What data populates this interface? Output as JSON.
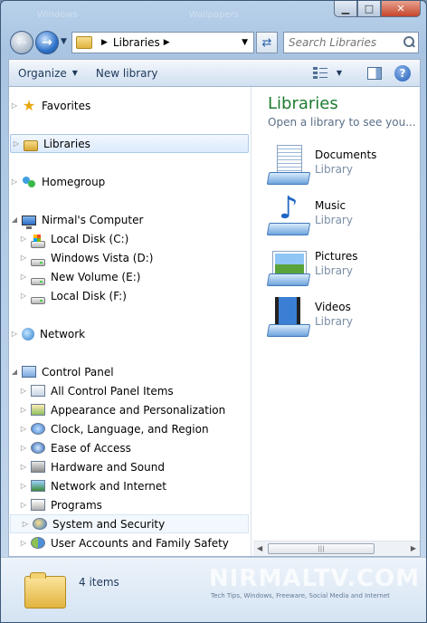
{
  "window": {
    "title_ghost": [
      "Windows",
      "Wallpapers"
    ]
  },
  "navigation": {
    "address_crumbs": [
      "Libraries"
    ],
    "search_placeholder": "Search Libraries"
  },
  "toolbar": {
    "organize_label": "Organize",
    "new_library_label": "New library"
  },
  "nav_tree": [
    {
      "label": "Favorites",
      "level": 0,
      "icon": "star-icon",
      "expanded": false
    },
    {
      "label": "Libraries",
      "level": 0,
      "icon": "library-icon",
      "expanded": false,
      "selected": true
    },
    {
      "label": "Homegroup",
      "level": 0,
      "icon": "homegroup-icon",
      "expanded": false
    },
    {
      "label": "Nirmal's Computer",
      "level": 0,
      "icon": "computer-icon",
      "expanded": true
    },
    {
      "label": "Local Disk (C:)",
      "level": 1,
      "icon": "windows-drive-icon"
    },
    {
      "label": "Windows Vista (D:)",
      "level": 1,
      "icon": "drive-icon"
    },
    {
      "label": "New Volume (E:)",
      "level": 1,
      "icon": "drive-icon"
    },
    {
      "label": "Local Disk (F:)",
      "level": 1,
      "icon": "drive-icon"
    },
    {
      "label": "Network",
      "level": 0,
      "icon": "network-icon",
      "expanded": false
    },
    {
      "label": "Control Panel",
      "level": 0,
      "icon": "control-panel-icon",
      "expanded": true
    },
    {
      "label": "All Control Panel Items",
      "level": 1,
      "icon": "control-panel-items-icon"
    },
    {
      "label": "Appearance and Personalization",
      "level": 1,
      "icon": "appearance-icon"
    },
    {
      "label": "Clock, Language, and Region",
      "level": 1,
      "icon": "clock-icon"
    },
    {
      "label": "Ease of Access",
      "level": 1,
      "icon": "ease-of-access-icon"
    },
    {
      "label": "Hardware and Sound",
      "level": 1,
      "icon": "hardware-icon"
    },
    {
      "label": "Network and Internet",
      "level": 1,
      "icon": "network-internet-icon"
    },
    {
      "label": "Programs",
      "level": 1,
      "icon": "programs-icon"
    },
    {
      "label": "System and Security",
      "level": 1,
      "icon": "security-icon",
      "hovered": true
    },
    {
      "label": "User Accounts and Family Safety",
      "level": 1,
      "icon": "user-accounts-icon"
    }
  ],
  "libraries_pane": {
    "title": "Libraries",
    "subtitle": "Open a library to see you...",
    "items": [
      {
        "name": "Documents",
        "kind": "Library",
        "icon": "documents-library-icon"
      },
      {
        "name": "Music",
        "kind": "Library",
        "icon": "music-library-icon"
      },
      {
        "name": "Pictures",
        "kind": "Library",
        "icon": "pictures-library-icon"
      },
      {
        "name": "Videos",
        "kind": "Library",
        "icon": "videos-library-icon"
      }
    ]
  },
  "details": {
    "count_label": "4 items",
    "watermark": "NIRMALTV.COM",
    "watermark_sub": "Tech Tips, Windows, Freeware, Social Media and Internet"
  }
}
